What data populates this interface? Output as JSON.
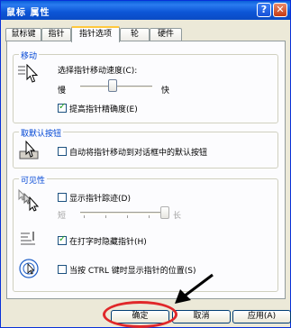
{
  "window": {
    "title": "鼠标 属性"
  },
  "titlebar": {
    "help_glyph": "?",
    "close_glyph": "✕"
  },
  "tabs": [
    {
      "label": "鼠标键"
    },
    {
      "label": "指针"
    },
    {
      "label": "指针选项"
    },
    {
      "label": "轮"
    },
    {
      "label": "硬件"
    }
  ],
  "motion": {
    "group_title": "移动",
    "speed_label": "选择指针移动速度(C):",
    "slow": "慢",
    "fast": "快",
    "speed_level": 0.45,
    "precision_label": "提高指针精确度(E)",
    "precision_checked": true
  },
  "snap": {
    "group_title": "取默认按钮",
    "snap_label": "自动将指针移动到对话框中的默认按钮",
    "snap_checked": false
  },
  "visibility": {
    "group_title": "可见性",
    "trails_label": "显示指针踪迹(D)",
    "trails_checked": false,
    "short": "短",
    "long": "长",
    "trail_level": 1.0,
    "hide_label": "在打字时隐藏指针(H)",
    "hide_checked": true,
    "ctrl_label": "当按 CTRL 键时显示指针的位置(S)",
    "ctrl_checked": false
  },
  "buttons": {
    "ok": "确定",
    "cancel": "取消",
    "apply": "应用(A)"
  },
  "colors": {
    "annotation": "#e0282a",
    "accent": "#0046d5"
  }
}
